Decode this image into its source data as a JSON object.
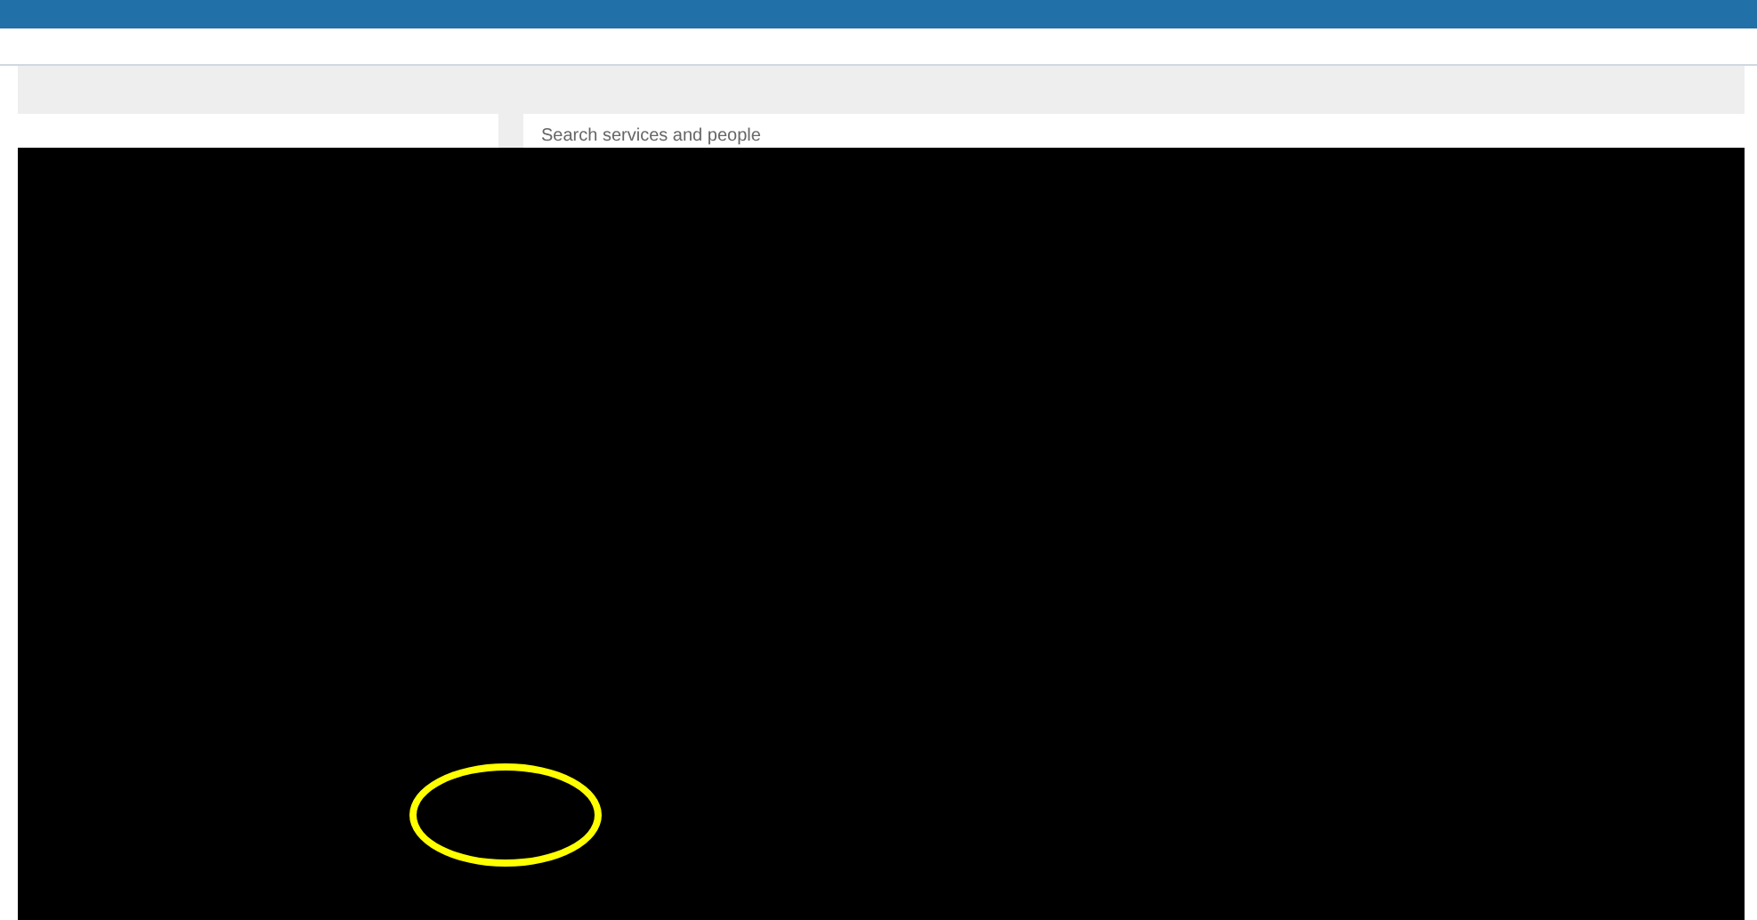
{
  "search": {
    "placeholder": "Search services and people"
  },
  "overlay": {
    "highlight": true
  }
}
